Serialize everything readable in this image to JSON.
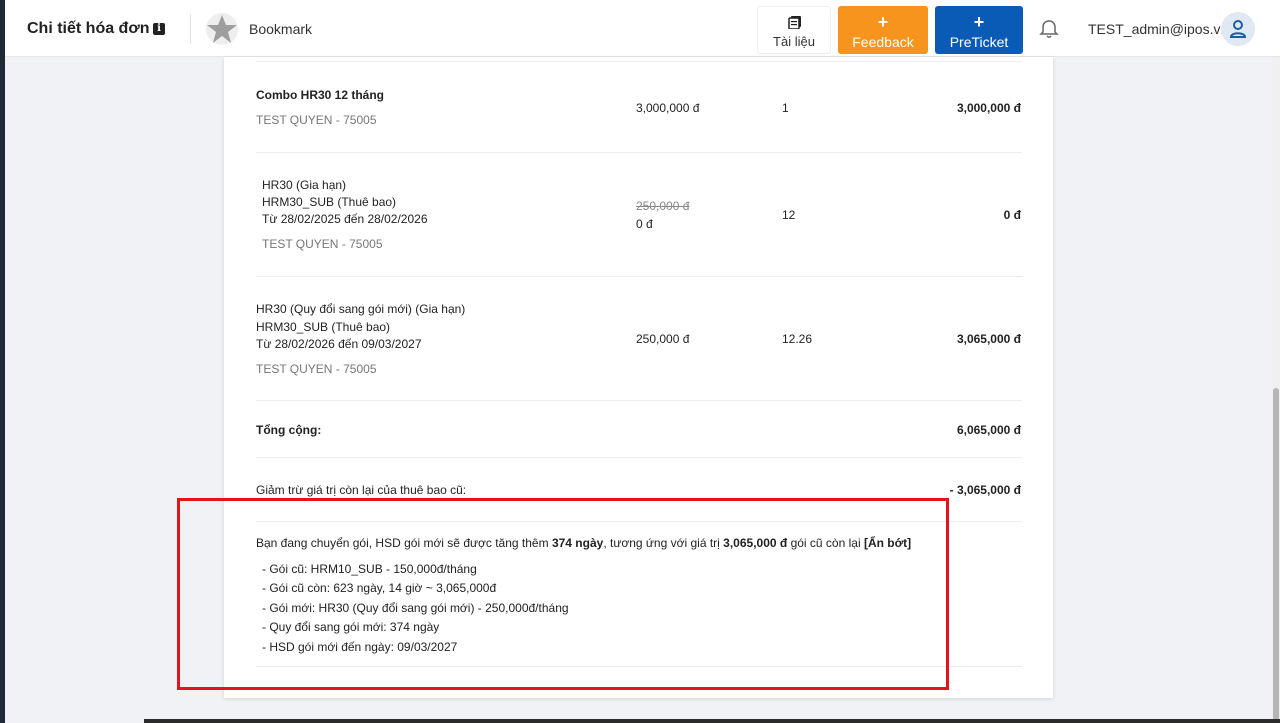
{
  "header": {
    "title": "Chi tiết hóa đơn",
    "bookmark_label": "Bookmark",
    "docs_label": "Tài liệu",
    "feedback_label": "Feedback",
    "preticket_label": "PreTicket",
    "plus": "+",
    "user_email": "TEST_admin@ipos.vn",
    "feedback_color": "#f7941d",
    "preticket_color": "#0a5bb5"
  },
  "items": [
    {
      "lines": [
        "Combo HR30 12 tháng"
      ],
      "customer": "TEST QUYEN - 75005",
      "old_price": "",
      "price": "3,000,000 đ",
      "quantity": "1",
      "total": "3,000,000 đ"
    },
    {
      "lines": [
        "HR30 (Gia hạn)",
        "HRM30_SUB (Thuê bao)",
        "Từ 28/02/2025 đến 28/02/2026"
      ],
      "customer": "TEST QUYEN - 75005",
      "old_price": "250,000 đ",
      "price": "0 đ",
      "quantity": "12",
      "total": "0 đ"
    },
    {
      "lines": [
        "HR30 (Quy đổi sang gói mới) (Gia hạn)",
        "HRM30_SUB (Thuê bao)",
        "Từ 28/02/2026 đến 09/03/2027"
      ],
      "customer": "TEST QUYEN - 75005",
      "old_price": "",
      "price": "250,000 đ",
      "quantity": "12.26",
      "total": "3,065,000 đ"
    }
  ],
  "summary": {
    "total_label": "Tổng cộng:",
    "total_value": "6,065,000 đ",
    "deduction_label": "Giảm trừ giá trị còn lại của thuê bao cũ:",
    "deduction_value": "- 3,065,000 đ"
  },
  "conversion": {
    "intro_1": "Bạn đang chuyển gói, HSD gói mới sẽ được tăng thêm ",
    "days": "374 ngày",
    "intro_2": ", tương ứng với giá trị ",
    "value": "3,065,000 đ",
    "intro_3": " gói cũ còn lại ",
    "toggle_label": "[Ẩn bớt]",
    "details": [
      "- Gói cũ: HRM10_SUB - 150,000đ/tháng",
      "- Gói cũ còn: 623 ngày, 14 giờ ~ 3,065,000đ",
      "- Gói mới: HR30 (Quy đổi sang gói mới) - 250,000đ/tháng",
      "- Quy đổi sang gói mới: 374 ngày",
      "- HSD gói mới đến ngày: 09/03/2027"
    ],
    "highlight_color": "#e3141b"
  }
}
